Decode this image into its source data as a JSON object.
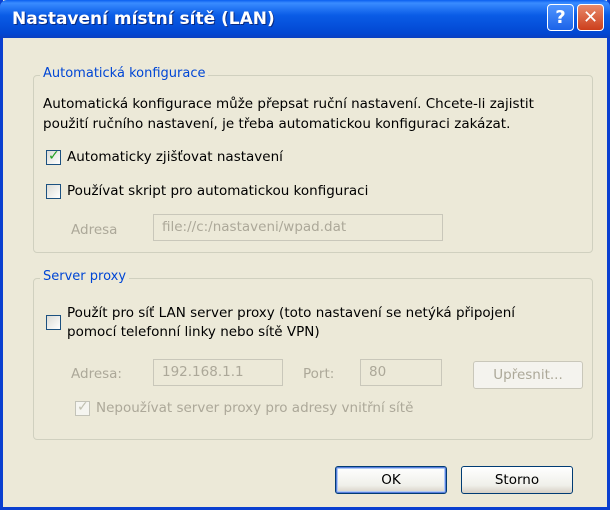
{
  "title": "Nastavení místní sítě (LAN)",
  "titlebar": {
    "help_glyph": "?",
    "close_glyph": "✕"
  },
  "auto": {
    "legend": "Automatická konfigurace",
    "desc_line1": "Automatická konfigurace může přepsat ruční nastavení. Chcete-li zajistit",
    "desc_line2": "použití ručního nastavení, je třeba automatickou konfiguraci zakázat.",
    "detect_label": "Automaticky zjišťovat nastavení",
    "detect_checked": true,
    "script_label": "Používat skript pro automatickou konfiguraci",
    "script_checked": false,
    "address_label": "Adresa",
    "address_value": "file://c:/nastaveni/wpad.dat"
  },
  "proxy": {
    "legend": "Server proxy",
    "use_label_line1": "Použít pro síť LAN server proxy (toto nastavení se netýká připojení",
    "use_label_line2": "pomocí telefonní linky nebo sítě VPN)",
    "use_checked": false,
    "address_label": "Adresa:",
    "address_value": "192.168.1.1",
    "port_label": "Port:",
    "port_value": "80",
    "advanced_label": "Upřesnit...",
    "bypass_label": "Nepoužívat server proxy pro adresy vnitřní sítě",
    "bypass_checked": true
  },
  "buttons": {
    "ok": "OK",
    "cancel": "Storno"
  }
}
